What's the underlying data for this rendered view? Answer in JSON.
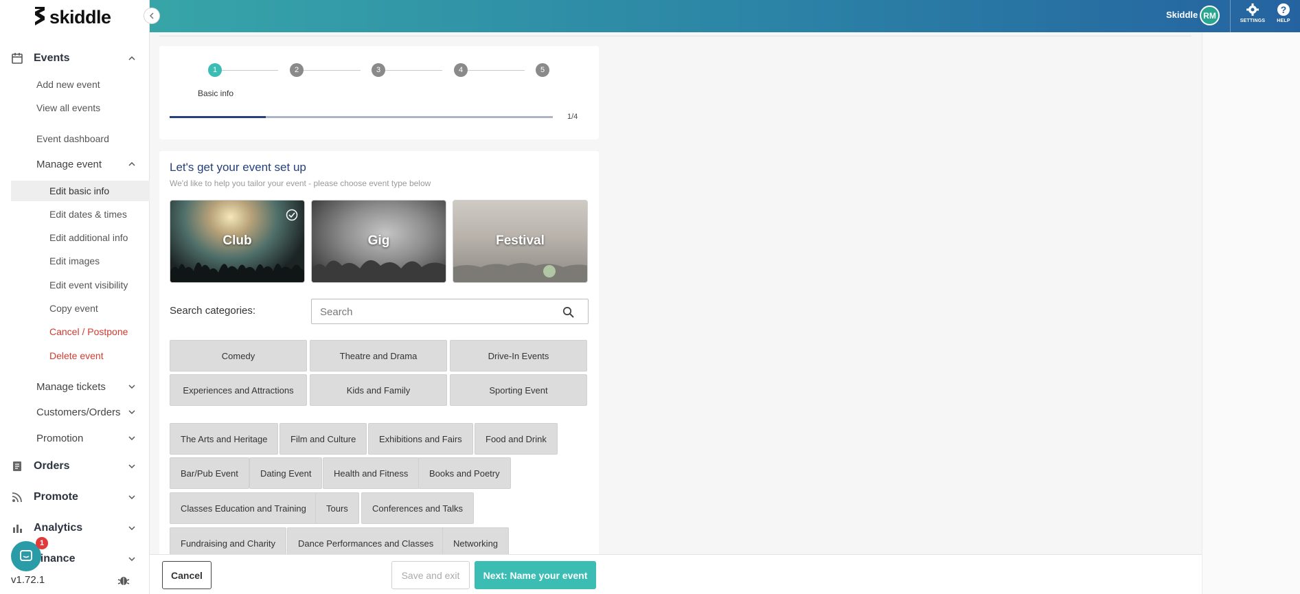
{
  "brand": {
    "name": "skiddle"
  },
  "header": {
    "user_name": "Skiddle",
    "avatar_initials": "RM",
    "settings_label": "SETTINGS",
    "help_label": "HELP"
  },
  "sidebar": {
    "events_label": "Events",
    "add_new_event": "Add new event",
    "view_all_events": "View all events",
    "event_dashboard": "Event dashboard",
    "manage_event": "Manage event",
    "edit_basic_info": "Edit basic info",
    "edit_dates_times": "Edit dates & times",
    "edit_additional_info": "Edit additional info",
    "edit_images": "Edit images",
    "edit_event_visibility": "Edit event visibility",
    "copy_event": "Copy event",
    "cancel_postpone": "Cancel / Postpone",
    "delete_event": "Delete event",
    "manage_tickets": "Manage tickets",
    "customers_orders": "Customers/Orders",
    "promotion": "Promotion",
    "orders_label": "Orders",
    "promote_label": "Promote",
    "analytics_label": "Analytics",
    "finance_label": "Finance",
    "intercom_badge": "1",
    "version": "v1.72.1"
  },
  "wizard": {
    "steps": [
      "1",
      "2",
      "3",
      "4",
      "5"
    ],
    "active_step_caption": "Basic info",
    "progress_label": "1/4",
    "progress_fraction": 0.25
  },
  "setup": {
    "title": "Let's get your event set up",
    "subtitle": "We'd like to help you tailor your event - please choose event type below",
    "types": [
      "Club",
      "Gig",
      "Festival"
    ],
    "selected_type": "Club",
    "search_label": "Search categories:",
    "search_placeholder": "Search",
    "featured_categories": [
      "Comedy",
      "Theatre and Drama",
      "Drive-In Events",
      "Experiences and Attractions",
      "Kids and Family",
      "Sporting Event"
    ],
    "categories": [
      "The Arts and Heritage",
      "Film and Culture",
      "Exhibitions and Fairs",
      "Food and Drink",
      "Bar/Pub Event",
      "Dating Event",
      "Health and Fitness",
      "Books and Poetry",
      "Classes Education and Training",
      "Tours",
      "Conferences and Talks",
      "Fundraising and Charity",
      "Dance Performances and Classes",
      "Networking"
    ]
  },
  "footer": {
    "cancel": "Cancel",
    "save_exit": "Save and exit",
    "next": "Next: Name your event"
  },
  "colors": {
    "accent_teal": "#3cbdb4",
    "navy": "#25407a",
    "danger": "#d03b2f"
  }
}
